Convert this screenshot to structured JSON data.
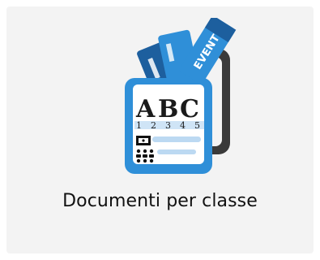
{
  "tile": {
    "label": "Documenti per classe",
    "icon": "class-documents-icon",
    "icon_text": {
      "letters": [
        "A",
        "B",
        "C"
      ],
      "numbers": [
        "1",
        "2",
        "3",
        "4",
        "5"
      ],
      "ticket_label": "EVENT"
    }
  },
  "colors": {
    "tile_background": "#f3f3f3",
    "icon_blue": "#2f8fd8",
    "icon_dark_blue": "#1d5f9e",
    "icon_gray": "#3a3a3a",
    "label_text": "#111111"
  }
}
